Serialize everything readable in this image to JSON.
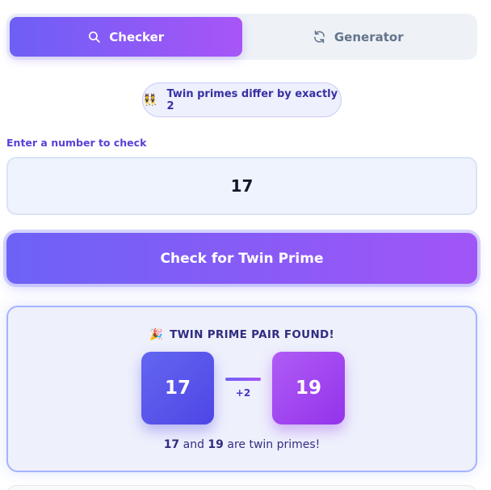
{
  "tabs": [
    {
      "label": "Checker",
      "icon": "search-icon",
      "active": true
    },
    {
      "label": "Generator",
      "icon": "refresh-icon",
      "active": false
    }
  ],
  "hint": {
    "emoji": "👯",
    "text": "Twin primes differ by exactly 2"
  },
  "form": {
    "label": "Enter a number to check",
    "value": "17",
    "button": "Check for Twin Prime"
  },
  "result": {
    "emoji": "🎉",
    "title": "TWIN PRIME PAIR FOUND!",
    "first": "17",
    "second": "19",
    "difference": "+2",
    "connector_word": "and",
    "suffix": "are twin primes!"
  },
  "colors": {
    "accent_start": "#6d5ff5",
    "accent_end": "#a855f7",
    "first_prime": "#4f46e5",
    "second_prime": "#9333ea"
  }
}
